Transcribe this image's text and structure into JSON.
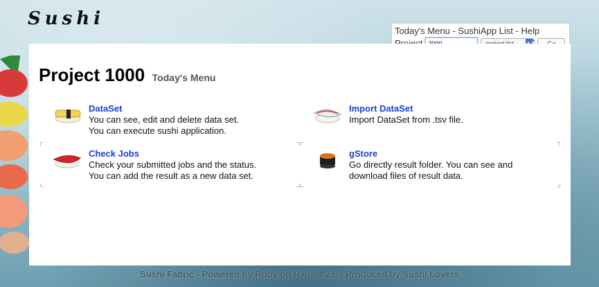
{
  "brand": {
    "logo_text": "Sushi"
  },
  "header_menu": {
    "todays_menu": "Today's Menu",
    "sep1": "-",
    "sushiapp_list": "SushiApp List",
    "sep2": "-",
    "help": "Help",
    "project_label": "Project",
    "project_value": "2000",
    "select_value": "project list",
    "go_label": "Go"
  },
  "main": {
    "title": "Project 1000",
    "subtitle": "Today's Menu",
    "items": [
      {
        "title": "DataSet",
        "lines": [
          "You can see, edit and delete data set.",
          "You can execute sushi application."
        ],
        "icon": "tamago-sushi-icon"
      },
      {
        "title": "Import DataSet",
        "lines": [
          "Import DataSet from .tsv file."
        ],
        "icon": "salmon-sushi-icon"
      },
      {
        "title": "Check Jobs",
        "lines": [
          "Check your submitted jobs and the status.",
          "You can add the result as a new data set."
        ],
        "icon": "tuna-sushi-icon"
      },
      {
        "title": "gStore",
        "lines": [
          "Go directly result folder. You can see and",
          "download files of result data."
        ],
        "icon": "gunkan-sushi-icon"
      }
    ]
  },
  "footer": {
    "text": "Sushi Fabric - Powered by Ruby on Rails 4.2.6 - Produced by Sushi Lovers"
  }
}
